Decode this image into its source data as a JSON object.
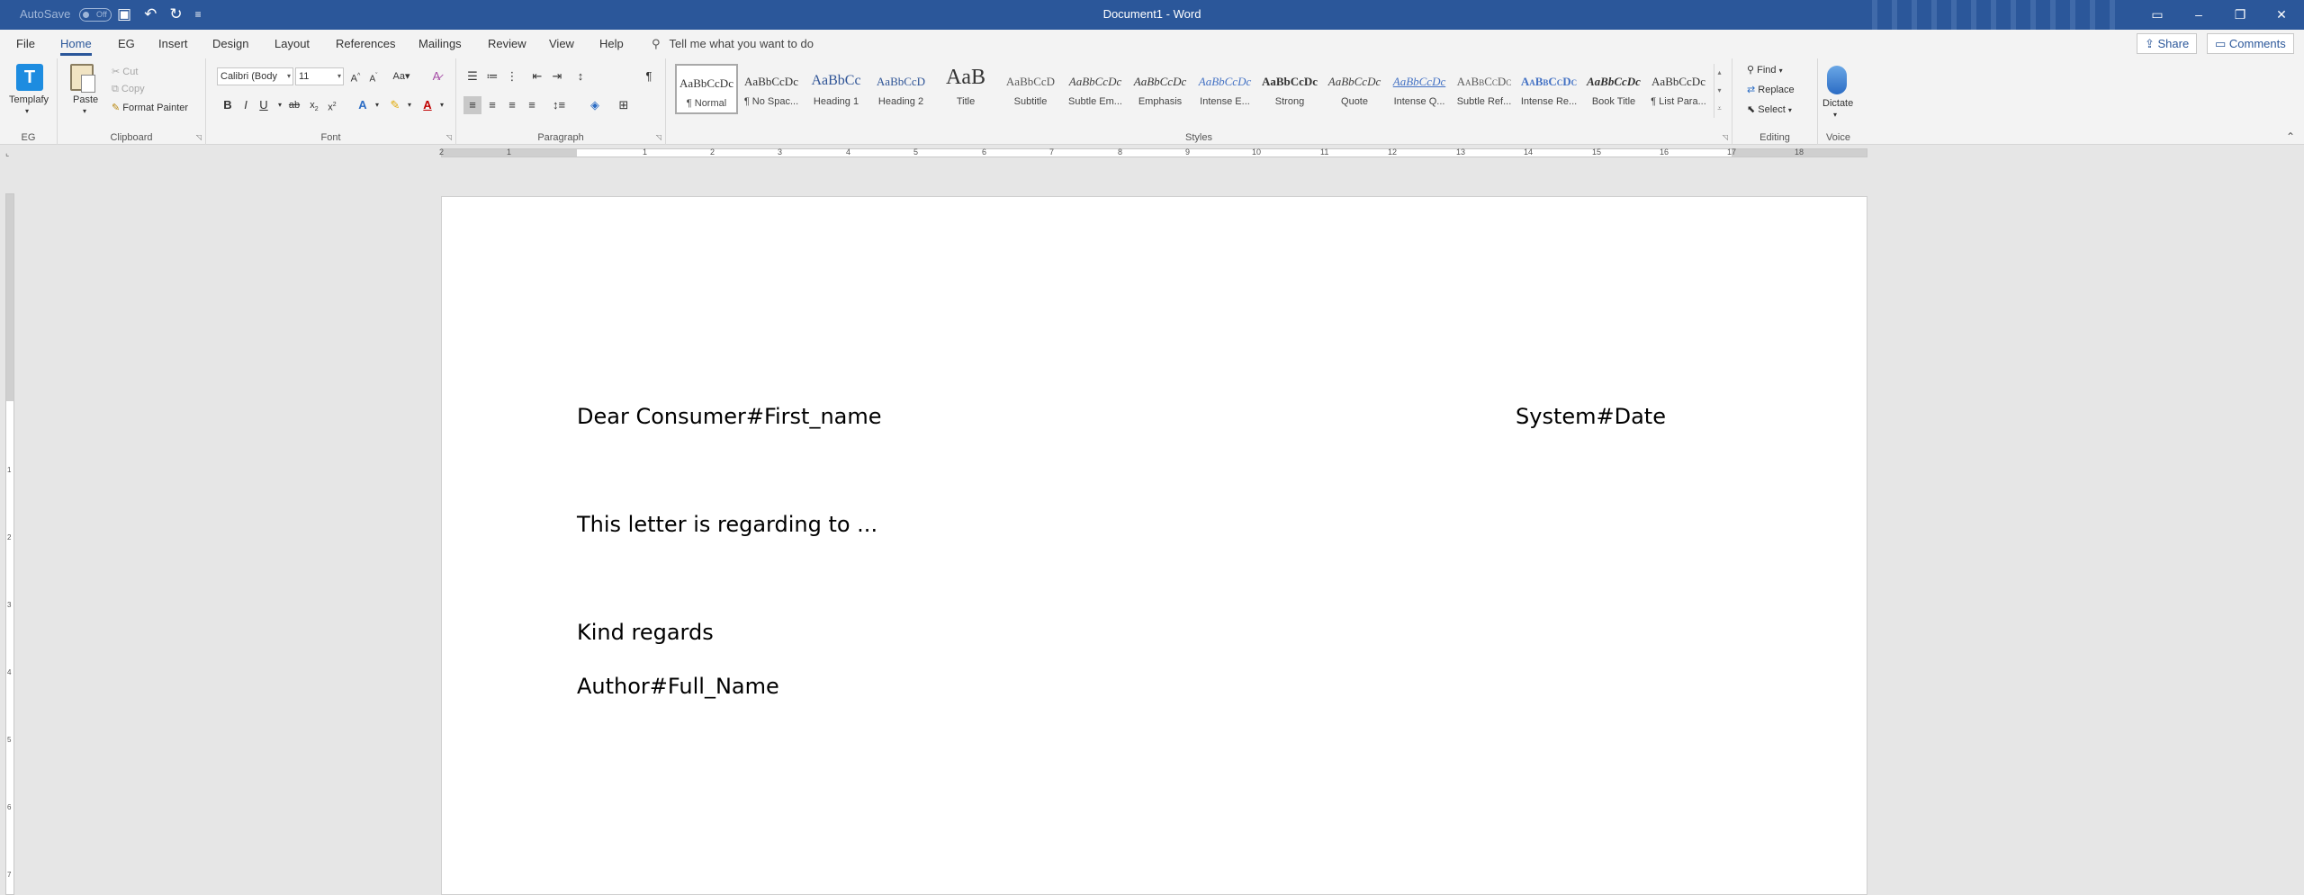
{
  "titlebar": {
    "autosave_label": "AutoSave",
    "autosave_state": "Off",
    "document_title": "Document1  -  Word"
  },
  "tabs": [
    "File",
    "Home",
    "EG",
    "Insert",
    "Design",
    "Layout",
    "References",
    "Mailings",
    "Review",
    "View",
    "Help"
  ],
  "active_tab": "Home",
  "tell_me": "Tell me what you want to do",
  "share_label": "Share",
  "comments_label": "Comments",
  "ribbon": {
    "eg": {
      "button": "Templafy",
      "group": "EG"
    },
    "clipboard": {
      "paste": "Paste",
      "cut": "Cut",
      "copy": "Copy",
      "format_painter": "Format Painter",
      "group": "Clipboard"
    },
    "font": {
      "name": "Calibri (Body",
      "size": "11",
      "group": "Font"
    },
    "paragraph": {
      "group": "Paragraph"
    },
    "styles": {
      "group": "Styles",
      "items": [
        {
          "preview": "AaBbCcDc",
          "name": "¶ Normal"
        },
        {
          "preview": "AaBbCcDc",
          "name": "¶ No Spac..."
        },
        {
          "preview": "AaBbCc",
          "name": "Heading 1"
        },
        {
          "preview": "AaBbCcD",
          "name": "Heading 2"
        },
        {
          "preview": "AaB",
          "name": "Title"
        },
        {
          "preview": "AaBbCcD",
          "name": "Subtitle"
        },
        {
          "preview": "AaBbCcDc",
          "name": "Subtle Em..."
        },
        {
          "preview": "AaBbCcDc",
          "name": "Emphasis"
        },
        {
          "preview": "AaBbCcDc",
          "name": "Intense E..."
        },
        {
          "preview": "AaBbCcDc",
          "name": "Strong"
        },
        {
          "preview": "AaBbCcDc",
          "name": "Quote"
        },
        {
          "preview": "AaBbCcDc",
          "name": "Intense Q..."
        },
        {
          "preview": "AaBbCcDc",
          "name": "Subtle Ref..."
        },
        {
          "preview": "AaBbCcDc",
          "name": "Intense Re..."
        },
        {
          "preview": "AaBbCcDc",
          "name": "Book Title"
        },
        {
          "preview": "AaBbCcDc",
          "name": "¶ List Para..."
        }
      ]
    },
    "editing": {
      "find": "Find",
      "replace": "Replace",
      "select": "Select",
      "group": "Editing"
    },
    "voice": {
      "dictate": "Dictate",
      "group": "Voice"
    }
  },
  "ruler_numbers": [
    "2",
    "1",
    "1",
    "2",
    "3",
    "4",
    "5",
    "6",
    "7",
    "8",
    "9",
    "10",
    "11",
    "12",
    "13",
    "14",
    "15",
    "16",
    "17",
    "18"
  ],
  "vruler_numbers": [
    "1",
    "2",
    "3",
    "4",
    "5",
    "6",
    "7"
  ],
  "document": {
    "salutation": "Dear Consumer#First_name",
    "date_field": "System#Date",
    "body": "This letter is regarding to ...",
    "closing": "Kind regards",
    "signature": "Author#Full_Name"
  },
  "colors": {
    "titlebar": "#2b579a",
    "accent": "#2b579a"
  }
}
